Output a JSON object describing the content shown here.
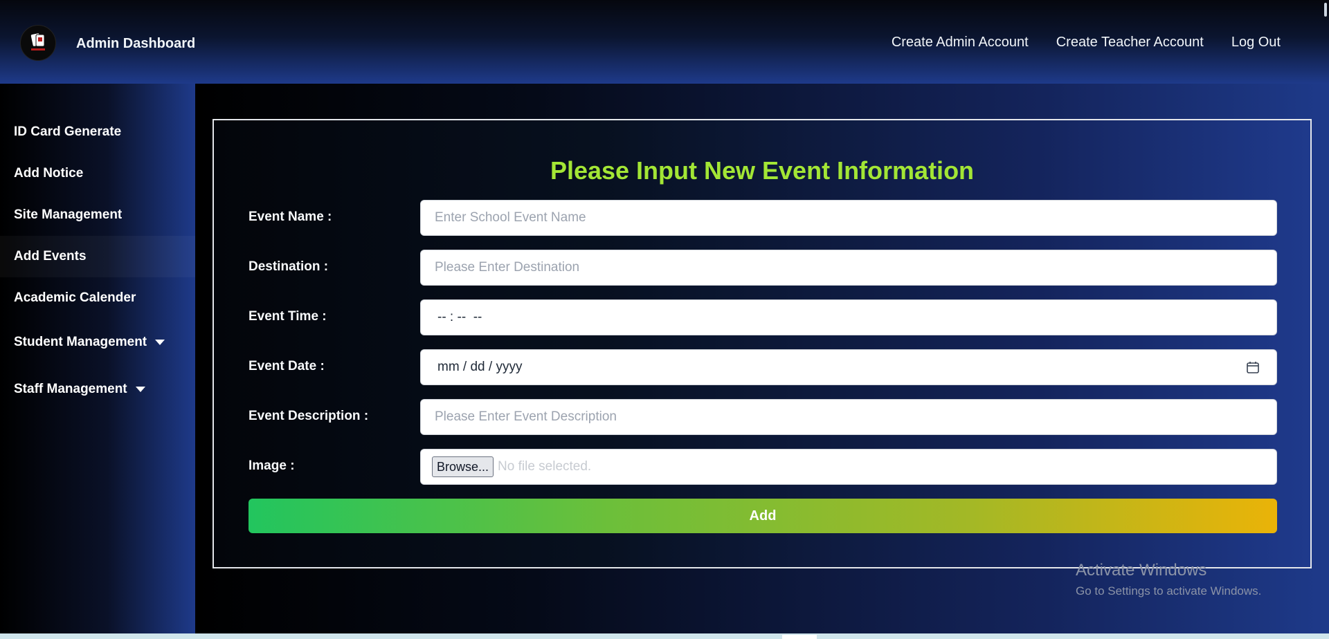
{
  "header": {
    "brand": "Admin Dashboard",
    "logo_icon": "id-cards-logo-icon",
    "nav": [
      {
        "label": "Create Admin Account"
      },
      {
        "label": "Create Teacher Account"
      },
      {
        "label": "Log Out"
      }
    ]
  },
  "sidebar": {
    "items": [
      {
        "label": "ID Card Generate"
      },
      {
        "label": "Add Notice"
      },
      {
        "label": "Site Management"
      },
      {
        "label": "Add Events",
        "active": true
      },
      {
        "label": "Academic Calender"
      },
      {
        "label": "Student Management",
        "dropdown": true
      },
      {
        "label": "Staff Management",
        "dropdown": true
      }
    ]
  },
  "form": {
    "title": "Please Input New Event Information",
    "fields": {
      "event_name": {
        "label": "Event Name :",
        "placeholder": "Enter School Event Name"
      },
      "destination": {
        "label": "Destination :",
        "placeholder": "Please Enter Destination"
      },
      "event_time": {
        "label": "Event Time :",
        "value": "-- : --  --"
      },
      "event_date": {
        "label": "Event Date :",
        "value": "mm / dd / yyyy",
        "icon": "calendar-icon"
      },
      "event_description": {
        "label": "Event Description :",
        "placeholder": "Please Enter Event Description"
      },
      "image": {
        "label": "Image :",
        "button": "Browse...",
        "status": "No file selected."
      }
    },
    "submit_label": "Add"
  },
  "watermark": {
    "title": "Activate Windows",
    "subtitle": "Go to Settings to activate Windows."
  },
  "colors": {
    "accent_title": "#a3e635",
    "button_start": "#22c55e",
    "button_end": "#eab308",
    "header_blue": "#1e3a8a"
  }
}
